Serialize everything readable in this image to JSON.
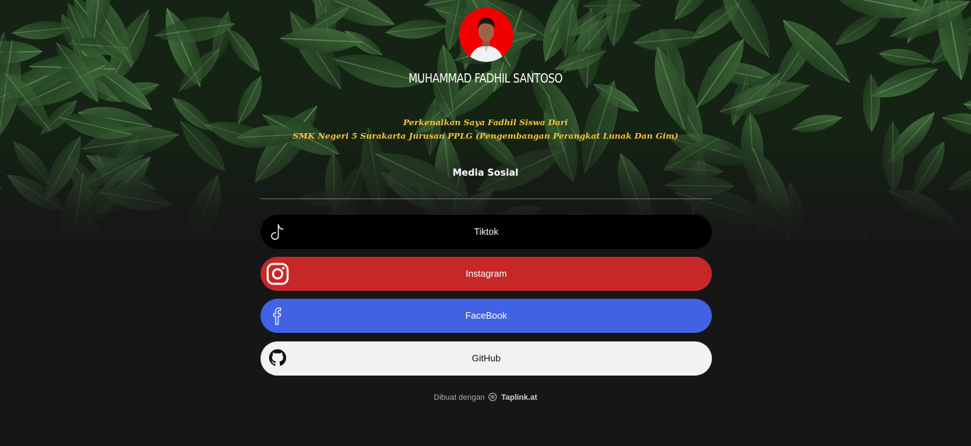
{
  "profile": {
    "name": "MUHAMMAD FADHIL SANTOSO",
    "bio_line1": "Perkenalkan Saya Fadhil Siswa Dari",
    "bio_line2": "SMK Negeri 5 Surakarta Jurusan PPLG (Pengembangan Perangkat Lunak Dan Gim)",
    "avatar_bg": "#f00000"
  },
  "section": {
    "title": "Media Sosial"
  },
  "links": [
    {
      "label": "Tiktok",
      "icon": "tiktok-icon",
      "color": "#000000"
    },
    {
      "label": "Instagram",
      "icon": "instagram-icon",
      "color": "#c62828"
    },
    {
      "label": "FaceBook",
      "icon": "facebook-icon",
      "color": "#4162e5"
    },
    {
      "label": "GitHub",
      "icon": "github-icon",
      "color": "#f1f2f3"
    }
  ],
  "footer": {
    "prefix": "Dibuat dengan",
    "brand": "Taplink.at"
  }
}
